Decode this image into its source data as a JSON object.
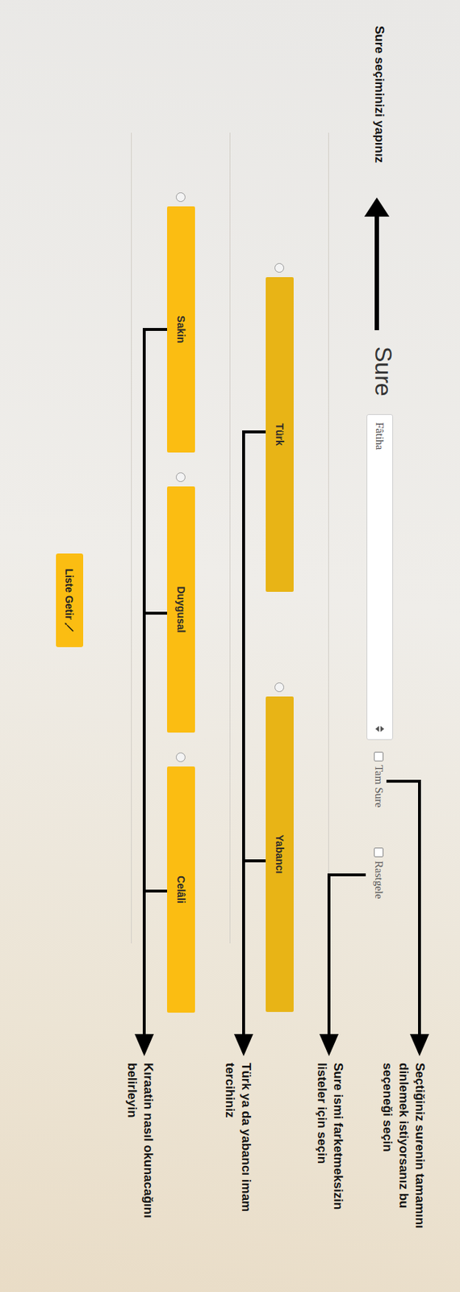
{
  "title": "Sure seçiminizi yapınız",
  "surah": {
    "label": "Sure",
    "value": "Fâtiha"
  },
  "options": [
    {
      "label": "Tam Sure",
      "checked": false
    },
    {
      "label": "Rastgele",
      "checked": false
    }
  ],
  "imams": [
    {
      "label": "Türk",
      "selected": false
    },
    {
      "label": "Yabancı",
      "selected": false
    }
  ],
  "styles": [
    {
      "label": "Sakin",
      "selected": false
    },
    {
      "label": "Duygusal",
      "selected": false
    },
    {
      "label": "Celâli",
      "selected": false
    }
  ],
  "submit": "Liste Getir",
  "notes": [
    {
      "lines": [
        "Seçtiğiniz surenin tamamını",
        "dinlemek istiyorsanız bu",
        "seçeneği seçin"
      ]
    },
    {
      "lines": [
        "Sure ismi farketmeksizin",
        "listeler için seçin"
      ]
    },
    {
      "lines": [
        "Türk ya da yabancı imam",
        "tercihiniz"
      ]
    },
    {
      "lines": [
        "Kıraatin nasıl okunacağını",
        "belirleyin"
      ]
    }
  ]
}
